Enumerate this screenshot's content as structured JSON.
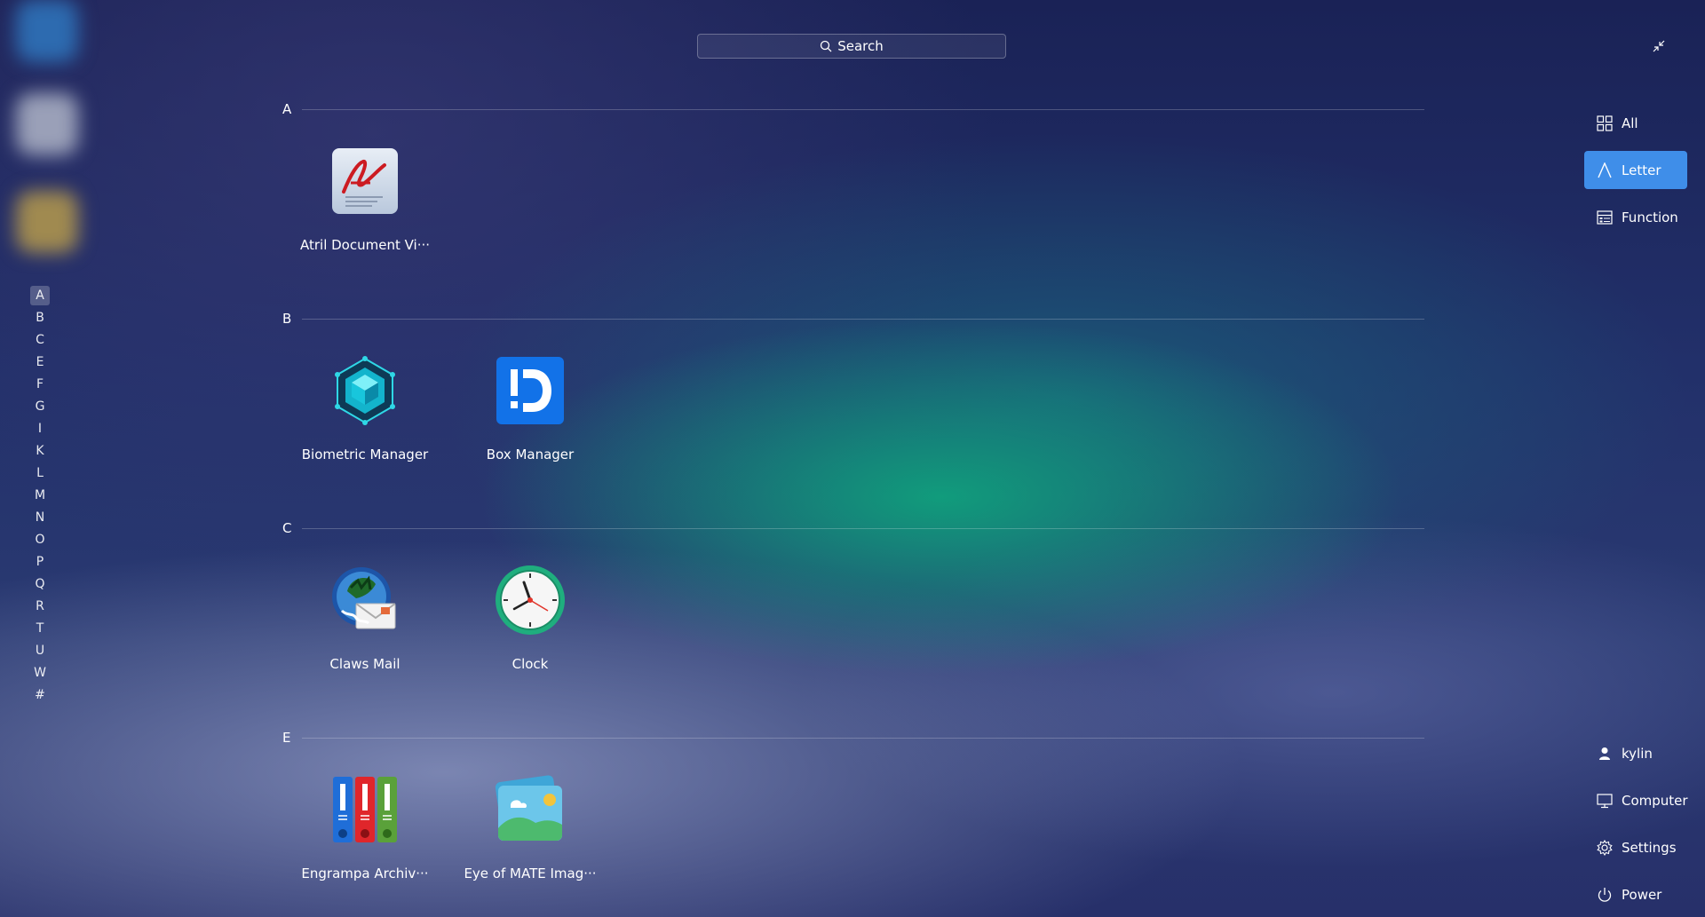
{
  "search": {
    "placeholder": "Search"
  },
  "letter_index": [
    "A",
    "B",
    "C",
    "E",
    "F",
    "G",
    "I",
    "K",
    "L",
    "M",
    "N",
    "O",
    "P",
    "Q",
    "R",
    "T",
    "U",
    "W",
    "#"
  ],
  "active_letter": "A",
  "sections": [
    {
      "letter": "A",
      "apps": [
        {
          "name": "Atril Document Vi···",
          "icon": "atril-icon"
        }
      ]
    },
    {
      "letter": "B",
      "apps": [
        {
          "name": "Biometric Manager",
          "icon": "biometric-icon"
        },
        {
          "name": "Box Manager",
          "icon": "box-manager-icon"
        }
      ]
    },
    {
      "letter": "C",
      "apps": [
        {
          "name": "Claws Mail",
          "icon": "claws-mail-icon"
        },
        {
          "name": "Clock",
          "icon": "clock-icon"
        }
      ]
    },
    {
      "letter": "E",
      "apps": [
        {
          "name": "Engrampa Archiv···",
          "icon": "engrampa-icon"
        },
        {
          "name": "Eye of MATE Imag···",
          "icon": "eye-of-mate-icon"
        }
      ]
    }
  ],
  "view_modes": [
    {
      "label": "All",
      "icon": "grid-icon"
    },
    {
      "label": "Letter",
      "icon": "letter-a-icon",
      "active": true
    },
    {
      "label": "Function",
      "icon": "function-list-icon"
    }
  ],
  "bottom_nav": [
    {
      "label": "kylin",
      "icon": "user-icon"
    },
    {
      "label": "Computer",
      "icon": "monitor-icon"
    },
    {
      "label": "Settings",
      "icon": "gear-icon"
    },
    {
      "label": "Power",
      "icon": "power-icon"
    }
  ],
  "colors": {
    "accent": "#3f8ee9"
  }
}
